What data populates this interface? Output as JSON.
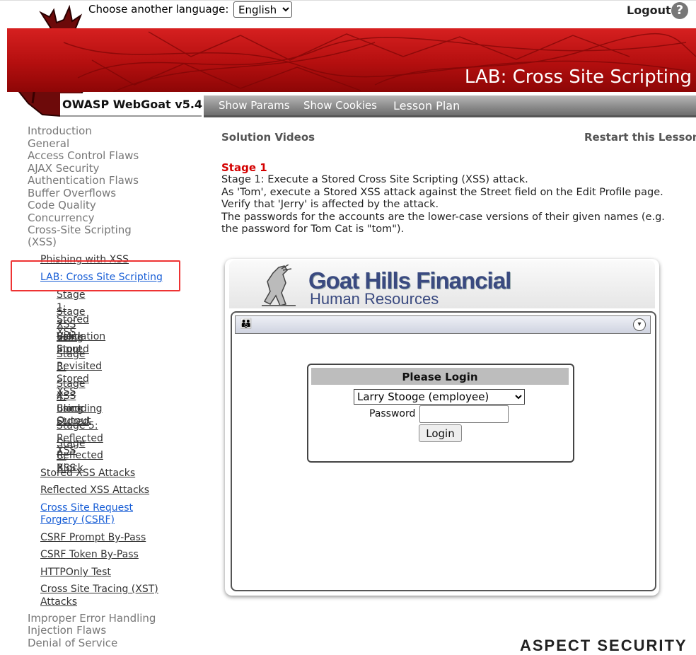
{
  "header": {
    "language_label": "Choose another language:",
    "language_selected": "English",
    "logout_label": "Logout",
    "help_glyph": "?",
    "banner_title": "LAB: Cross Site Scripting",
    "brand": "OWASP WebGoat v5.4",
    "toolbar": {
      "show_params": "Show Params",
      "show_cookies": "Show Cookies",
      "lesson_plan": "Lesson Plan"
    },
    "colors": {
      "banner": "#c41414",
      "toolbar": "#8c8c8c"
    }
  },
  "sidebar": {
    "categories_top": [
      "Introduction",
      "General",
      "Access Control Flaws",
      "AJAX Security",
      "Authentication Flaws",
      "Buffer Overflows",
      "Code Quality",
      "Concurrency",
      "Cross-Site Scripting",
      "(XSS)"
    ],
    "lessons": {
      "phishing": "Phishing with XSS",
      "lab": "LAB: Cross Site Scripting",
      "stored_attacks": "Stored XSS Attacks",
      "reflected_attacks": "Reflected XSS Attacks",
      "csrf_1": "Cross Site Request",
      "csrf_2": "Forgery (CSRF)",
      "csrf_prompt": "CSRF Prompt By-Pass",
      "csrf_token": "CSRF Token By-Pass",
      "httponly": "HTTPOnly Test",
      "xst_1": "Cross Site Tracing (XST)",
      "xst_2": "Attacks"
    },
    "stages": {
      "s1": "Stage 1: Stored XSS",
      "s2_1": "Stage 2: Block Stored",
      "s2_2": "XSS using Input",
      "s2_3": "Validation",
      "s3_1": "Stage 3: Stored XSS",
      "s3_2": "Revisited",
      "s4_1": "Stage 4: Block Stored",
      "s4_2": "XSS using Output",
      "s4_3": "Encoding",
      "s5": "Stage 5: Reflected XSS",
      "s6_1": "Stage 6: Block",
      "s6_2": "Reflected XSS"
    },
    "categories_bottom": [
      "Improper Error Handling",
      "Injection Flaws",
      "Denial of Service"
    ],
    "highlight_color": "#e33333"
  },
  "main": {
    "solution_videos": "Solution Videos",
    "restart": "Restart this Lesson",
    "stage_heading": "Stage 1",
    "instructions": [
      "Stage 1: Execute a Stored Cross Site Scripting (XSS) attack.",
      "As 'Tom', execute a Stored XSS attack against the Street field on the Edit Profile page.",
      "Verify that 'Jerry' is affected by the attack.",
      "The passwords for the accounts are the lower-case versions of their given names (e.g.",
      "the password for Tom Cat is \"tom\")."
    ],
    "stage_heading_color": "#d40000"
  },
  "app": {
    "title": "Goat Hills Financial",
    "subtitle": "Human Resources",
    "people_icon": "people-icon",
    "chevron_icon": "chevron-down-icon",
    "login": {
      "heading": "Please Login",
      "user_selected": "Larry Stooge (employee)",
      "password_label": "Password",
      "password_value": "",
      "button": "Login"
    },
    "title_color": "#3a4a80"
  },
  "footer": {
    "partial_logo": "ASPECT SECURITY"
  }
}
